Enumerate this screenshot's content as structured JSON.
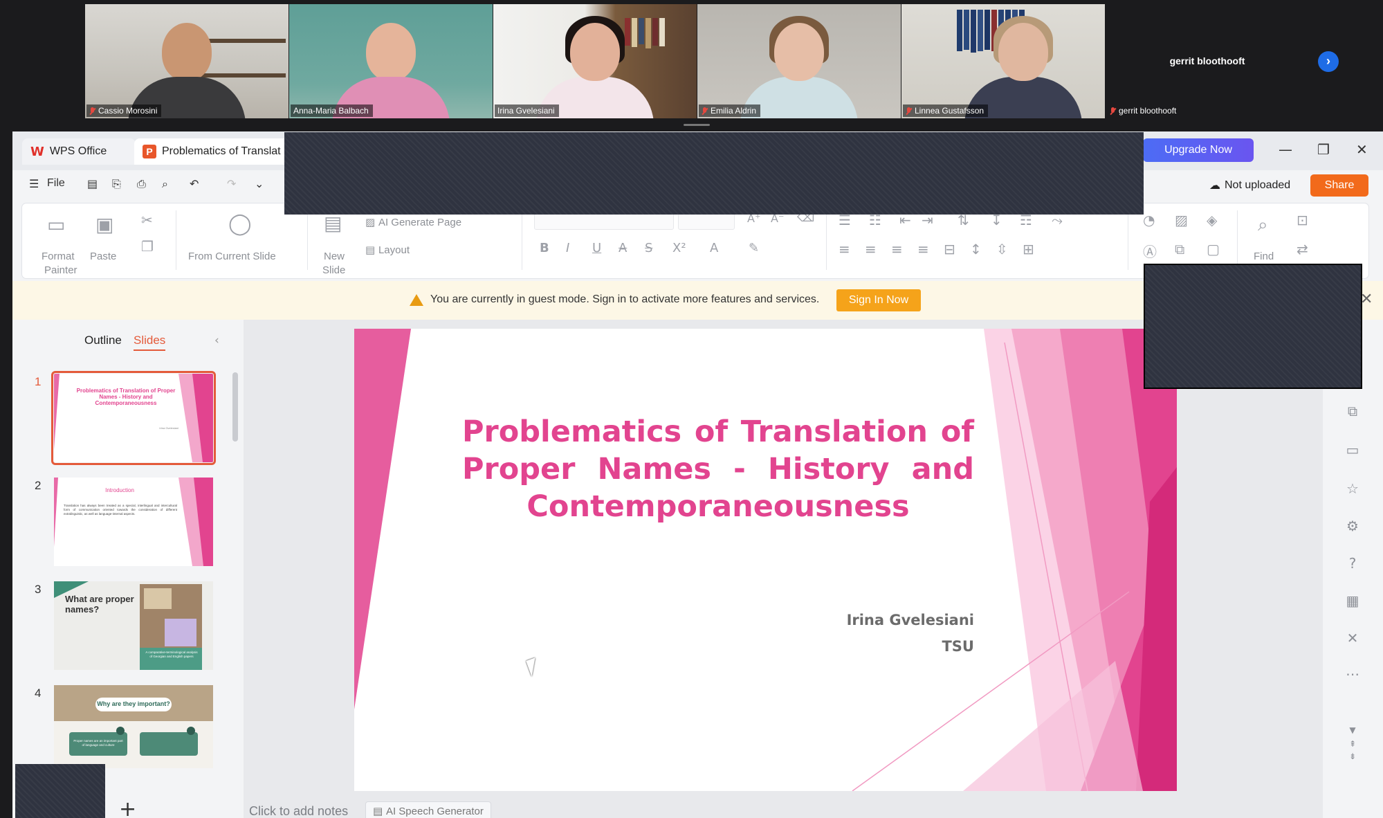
{
  "participants": [
    {
      "name": "Cassio Morosini",
      "muted": true
    },
    {
      "name": "Anna-Maria Balbach",
      "muted": false,
      "active": true
    },
    {
      "name": "Irina Gvelesiani",
      "muted": false
    },
    {
      "name": "Emilia Aldrin",
      "muted": true
    },
    {
      "name": "Linnea Gustafsson",
      "muted": true
    },
    {
      "name": "gerrit bloothooft",
      "muted": true
    }
  ],
  "gerrit_display_name": "gerrit bloothooft",
  "next_page_glyph": "›",
  "wps": {
    "home_tab": "WPS Office",
    "doc_tab": "Problematics of Translat",
    "upgrade": "Upgrade Now",
    "file_menu": "File",
    "not_uploaded": "Not uploaded",
    "share": "Share",
    "ribbon": {
      "format_painter_1": "Format",
      "format_painter_2": "Painter",
      "paste": "Paste",
      "from_current_slide": "From Current Slide",
      "new_slide_1": "New",
      "new_slide_2": "Slide",
      "ai_generate_page": "AI Generate Page",
      "layout": "Layout",
      "find": "Find"
    },
    "notice": {
      "text": "You are currently in guest mode. Sign in to activate more features and services.",
      "sign_in": "Sign In Now"
    },
    "pane": {
      "outline": "Outline",
      "slides": "Slides"
    },
    "thumbnails": [
      {
        "num": "1",
        "title": "Problematics of Translation of Proper Names - History and Contemporaneousness",
        "sub": "Irina Gvelesiani"
      },
      {
        "num": "2",
        "title": "Introduction",
        "sub": "Translation has always been treated as a special, interlingual and intercultural form of communication oriented towards the consideration of different extralinguistic, as well as language-internal aspects."
      },
      {
        "num": "3",
        "title": "What are proper names?",
        "sub": "A comparative-terminological analysis of Georgian and English papers"
      },
      {
        "num": "4",
        "title": "Why are they important?",
        "sub": "Proper names are an important part of language and culture"
      }
    ],
    "slide": {
      "title": "Problematics of Translation of Proper Names - History and Contemporaneousness",
      "author": "Irina Gvelesiani",
      "affiliation": "TSU"
    },
    "notes_placeholder": "Click to add notes",
    "ai_speech": "AI Speech Generator"
  },
  "colors": {
    "accent_pink": "#e2448f",
    "wps_red": "#e0302a",
    "share_orange": "#f26a1b",
    "signin_orange": "#f5a31a",
    "zoom_active_green": "#29c46a"
  }
}
